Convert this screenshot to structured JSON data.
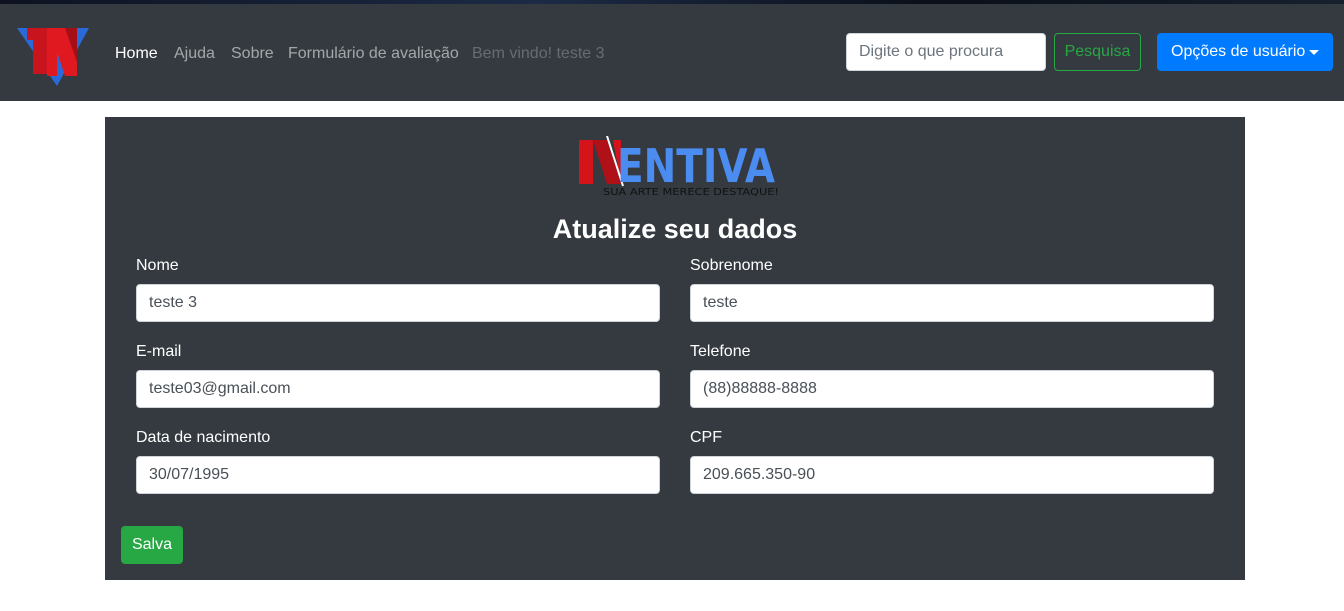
{
  "navbar": {
    "logo": {
      "icon": "inventiva-in-logo-icon",
      "colors": [
        "#1e63d6",
        "#d4131b"
      ]
    },
    "links": [
      {
        "label": "Home",
        "state": "active"
      },
      {
        "label": "Ajuda"
      },
      {
        "label": "Sobre"
      },
      {
        "label": "Formulário de avaliação"
      },
      {
        "label": "Bem vindo! teste 3",
        "state": "disabled"
      }
    ],
    "search": {
      "placeholder": "Digite o que procura",
      "value": ""
    },
    "search_button": "Pesquisa",
    "user_menu": {
      "label": "Opções de usuário",
      "icon": "caret-down-icon"
    }
  },
  "form": {
    "logo": {
      "text": "NVENTIVA",
      "tagline": "SUA ARTE MERECE DESTAQUE!"
    },
    "title": "Atualize seu dados",
    "fields": [
      {
        "label": "Nome",
        "value": "teste 3"
      },
      {
        "label": "Sobrenome",
        "value": "teste"
      },
      {
        "label": "E-mail",
        "value": "teste03@gmail.com"
      },
      {
        "label": "Telefone",
        "value": "(88)88888-8888"
      },
      {
        "label": "Data de nacimento",
        "value": "30/07/1995"
      },
      {
        "label": "CPF",
        "value": "209.665.350-90"
      }
    ],
    "save_button": "Salva"
  },
  "colors": {
    "navbar_bg": "#343a40",
    "panel_bg": "#343a40",
    "primary": "#007bff",
    "success": "#28a745"
  }
}
